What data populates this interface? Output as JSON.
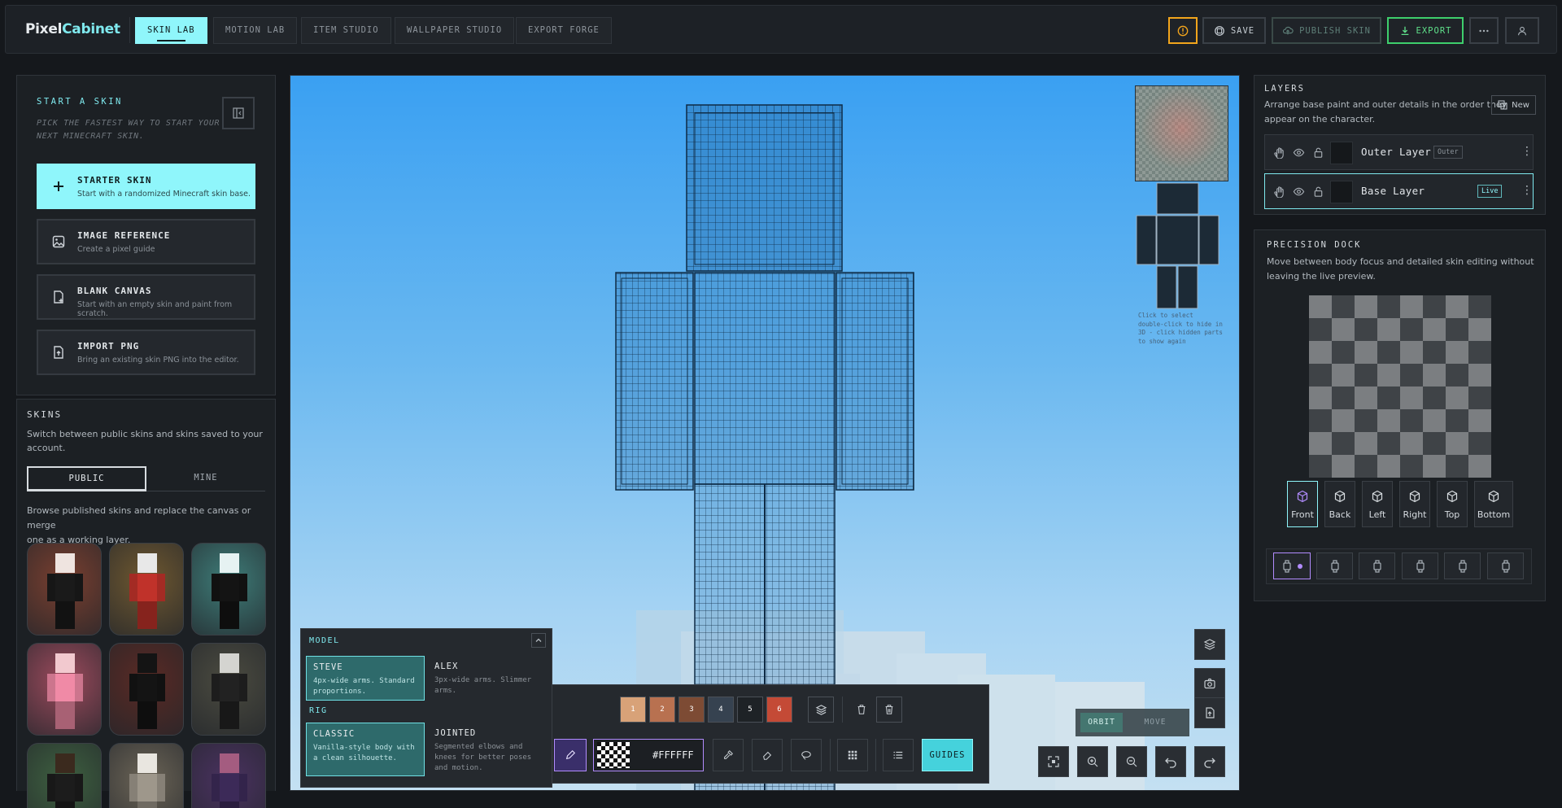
{
  "app": {
    "logo_main": "Pixel",
    "logo_accent": "Cabinet"
  },
  "tabs": [
    {
      "label": "SKIN LAB",
      "active": true
    },
    {
      "label": "MOTION LAB",
      "active": false
    },
    {
      "label": "ITEM STUDIO",
      "active": false
    },
    {
      "label": "WALLPAPER STUDIO",
      "active": false
    },
    {
      "label": "EXPORT FORGE",
      "active": false
    }
  ],
  "toolbar": {
    "save_label": "SAVE",
    "publish_label": "PUBLISH SKIN",
    "export_label": "EXPORT",
    "warning_icon": "warning-icon",
    "more_icon": "more-icon",
    "account_icon": "user-icon"
  },
  "start": {
    "eyebrow": "START A SKIN",
    "subtitle_line1": "PICK THE FASTEST WAY TO START YOUR",
    "subtitle_line2": "NEXT MINECRAFT SKIN.",
    "options": [
      {
        "title": "STARTER SKIN",
        "desc": "Start with a randomized Minecraft skin base.",
        "icon": "plus-icon"
      },
      {
        "title": "IMAGE REFERENCE",
        "desc": "Create a pixel guide",
        "icon": "image-icon"
      },
      {
        "title": "BLANK CANVAS",
        "desc": "Start with an empty skin and paint from scratch.",
        "icon": "file-plus-icon"
      },
      {
        "title": "IMPORT PNG",
        "desc": "Bring an existing skin PNG into the editor.",
        "icon": "file-import-icon"
      }
    ]
  },
  "skins": {
    "title": "SKINS",
    "desc_line1": "Switch between public skins and skins saved to your",
    "desc_line2": "account.",
    "tab_public": "PUBLIC",
    "tab_mine": "MINE",
    "browse_line1": "Browse published skins and replace the canvas or merge",
    "browse_line2": "one as a working layer.",
    "items": [
      {
        "bg": "#7a3f2f",
        "head": "#efe4e0",
        "body": "#1a1a1a"
      },
      {
        "bg": "#6f5830",
        "head": "#e8e8e8",
        "body": "#c0322a"
      },
      {
        "bg": "#3e7c78",
        "head": "#e6f2f2",
        "body": "#141414"
      },
      {
        "bg": "#9b4a5c",
        "head": "#f2c9cf",
        "body": "#f08aa6"
      },
      {
        "bg": "#5a2a24",
        "head": "#141414",
        "body": "#141414"
      },
      {
        "bg": "#4b4b40",
        "head": "#d4d4d0",
        "body": "#222222"
      },
      {
        "bg": "#3e6040",
        "head": "#3b2a1e",
        "body": "#1c1c1c"
      },
      {
        "bg": "#6b6456",
        "head": "#e9e6e0",
        "body": "#9e978b"
      },
      {
        "bg": "#4a3260",
        "head": "#a45c80",
        "body": "#3c2a58"
      }
    ]
  },
  "viewport": {
    "hint_line1": "Click to select",
    "hint_line2": "double-click to hide in",
    "hint_line3": "3D - click hidden parts",
    "hint_line4": "to show again",
    "orbit_label": "ORBIT",
    "move_label": "MOVE"
  },
  "model_panel": {
    "title": "MODEL",
    "rig_title": "RIG",
    "models": [
      {
        "name": "STEVE",
        "desc_l1": "4px-wide arms. Standard",
        "desc_l2": "proportions.",
        "selected": true
      },
      {
        "name": "ALEX",
        "desc_l1": "3px-wide arms. Slimmer",
        "desc_l2": "arms.",
        "selected": false
      }
    ],
    "rigs": [
      {
        "name": "CLASSIC",
        "desc_l1": "Vanilla-style body with",
        "desc_l2": "a clean silhouette.",
        "desc_l3": "",
        "selected": true
      },
      {
        "name": "JOINTED",
        "desc_l1": "Segmented elbows and",
        "desc_l2": "knees for better poses",
        "desc_l3": "and motion.",
        "selected": false
      }
    ]
  },
  "palette": {
    "swatches": [
      {
        "label": "1",
        "color": "#d8a278"
      },
      {
        "label": "2",
        "color": "#b87150"
      },
      {
        "label": "3",
        "color": "#7d4b34"
      },
      {
        "label": "4",
        "color": "#364250"
      },
      {
        "label": "5",
        "color": "#1e2226"
      },
      {
        "label": "6",
        "color": "#c44a36"
      }
    ],
    "hex": "#FFFFFF",
    "guides_label": "GUIDES"
  },
  "layers": {
    "title": "LAYERS",
    "desc_line1": "Arrange base paint and outer details in the order they",
    "desc_line2": "appear on the character.",
    "new_label": "New",
    "rows": [
      {
        "name": "Outer Layer",
        "badge": "Outer",
        "selected": false
      },
      {
        "name": "Base Layer",
        "badge": "Live",
        "selected": true
      }
    ]
  },
  "precision": {
    "title": "PRECISION DOCK",
    "desc_line1": "Move between body focus and detailed skin editing without",
    "desc_line2": "leaving the live preview.",
    "views": [
      "Front",
      "Back",
      "Left",
      "Right",
      "Top",
      "Bottom"
    ],
    "selected_view": "Front"
  },
  "colors": {
    "accent": "#8ff6fb",
    "warning": "#f2a51c",
    "export": "#3ecf6c",
    "purple": "#b28cff"
  }
}
